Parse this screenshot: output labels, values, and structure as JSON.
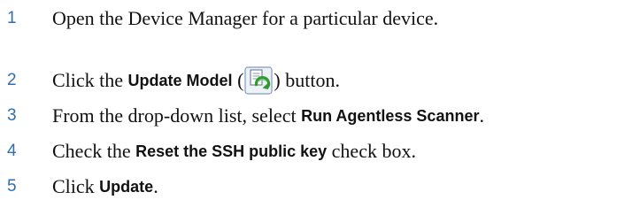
{
  "steps": [
    {
      "number": "1",
      "text": "Open the Device Manager for a particular device."
    },
    {
      "number": "2",
      "pre": "Click the ",
      "bold": "Update Model",
      "open_paren": " (",
      "icon": "update-model-icon",
      "post": ") button."
    },
    {
      "number": "3",
      "pre": "From the drop-down list, select ",
      "bold": "Run Agentless Scanner",
      "post": "."
    },
    {
      "number": "4",
      "pre": "Check the ",
      "bold": "Reset the SSH public key",
      "post": " check box."
    },
    {
      "number": "5",
      "pre": "Click ",
      "bold": "Update",
      "post": "."
    }
  ],
  "colors": {
    "step_number": "#2f6fb0",
    "body_text": "#111111"
  }
}
